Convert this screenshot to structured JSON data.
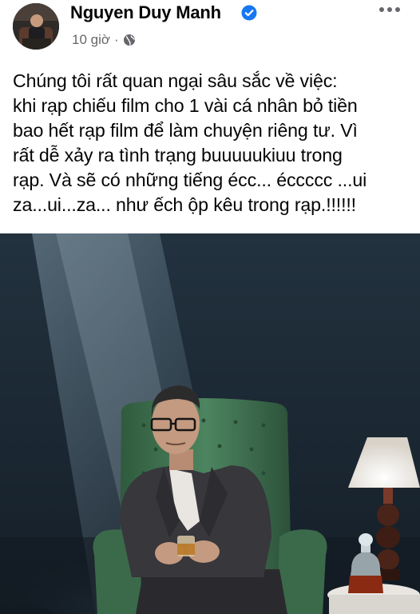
{
  "post": {
    "author_name": "Nguyen Duy Manh",
    "verified": true,
    "time_label": "10 giờ",
    "separator": "·",
    "audience_icon": "globe-icon",
    "more_icon": "more-horizontal-icon",
    "text_lines": [
      "Chúng tôi rất quan ngại sâu sắc về việc:",
      "khi rạp chiếu film cho 1 vài cá nhân bỏ tiền",
      "bao hết rạp film để làm chuyện riêng tư. Vì",
      "rất dễ xảy ra tình trạng buuuuukiuu trong",
      "rạp. Và sẽ có những tiếng écc... éccccc ...ui",
      "za...ui...za... như ếch ộp kêu trong rạp.!!!!!!"
    ]
  },
  "colors": {
    "name": "#050505",
    "meta": "#65676b",
    "verified_badge": "#1877f2",
    "photo_background": "#1b2630",
    "chair_green": "#3f6e4c"
  }
}
